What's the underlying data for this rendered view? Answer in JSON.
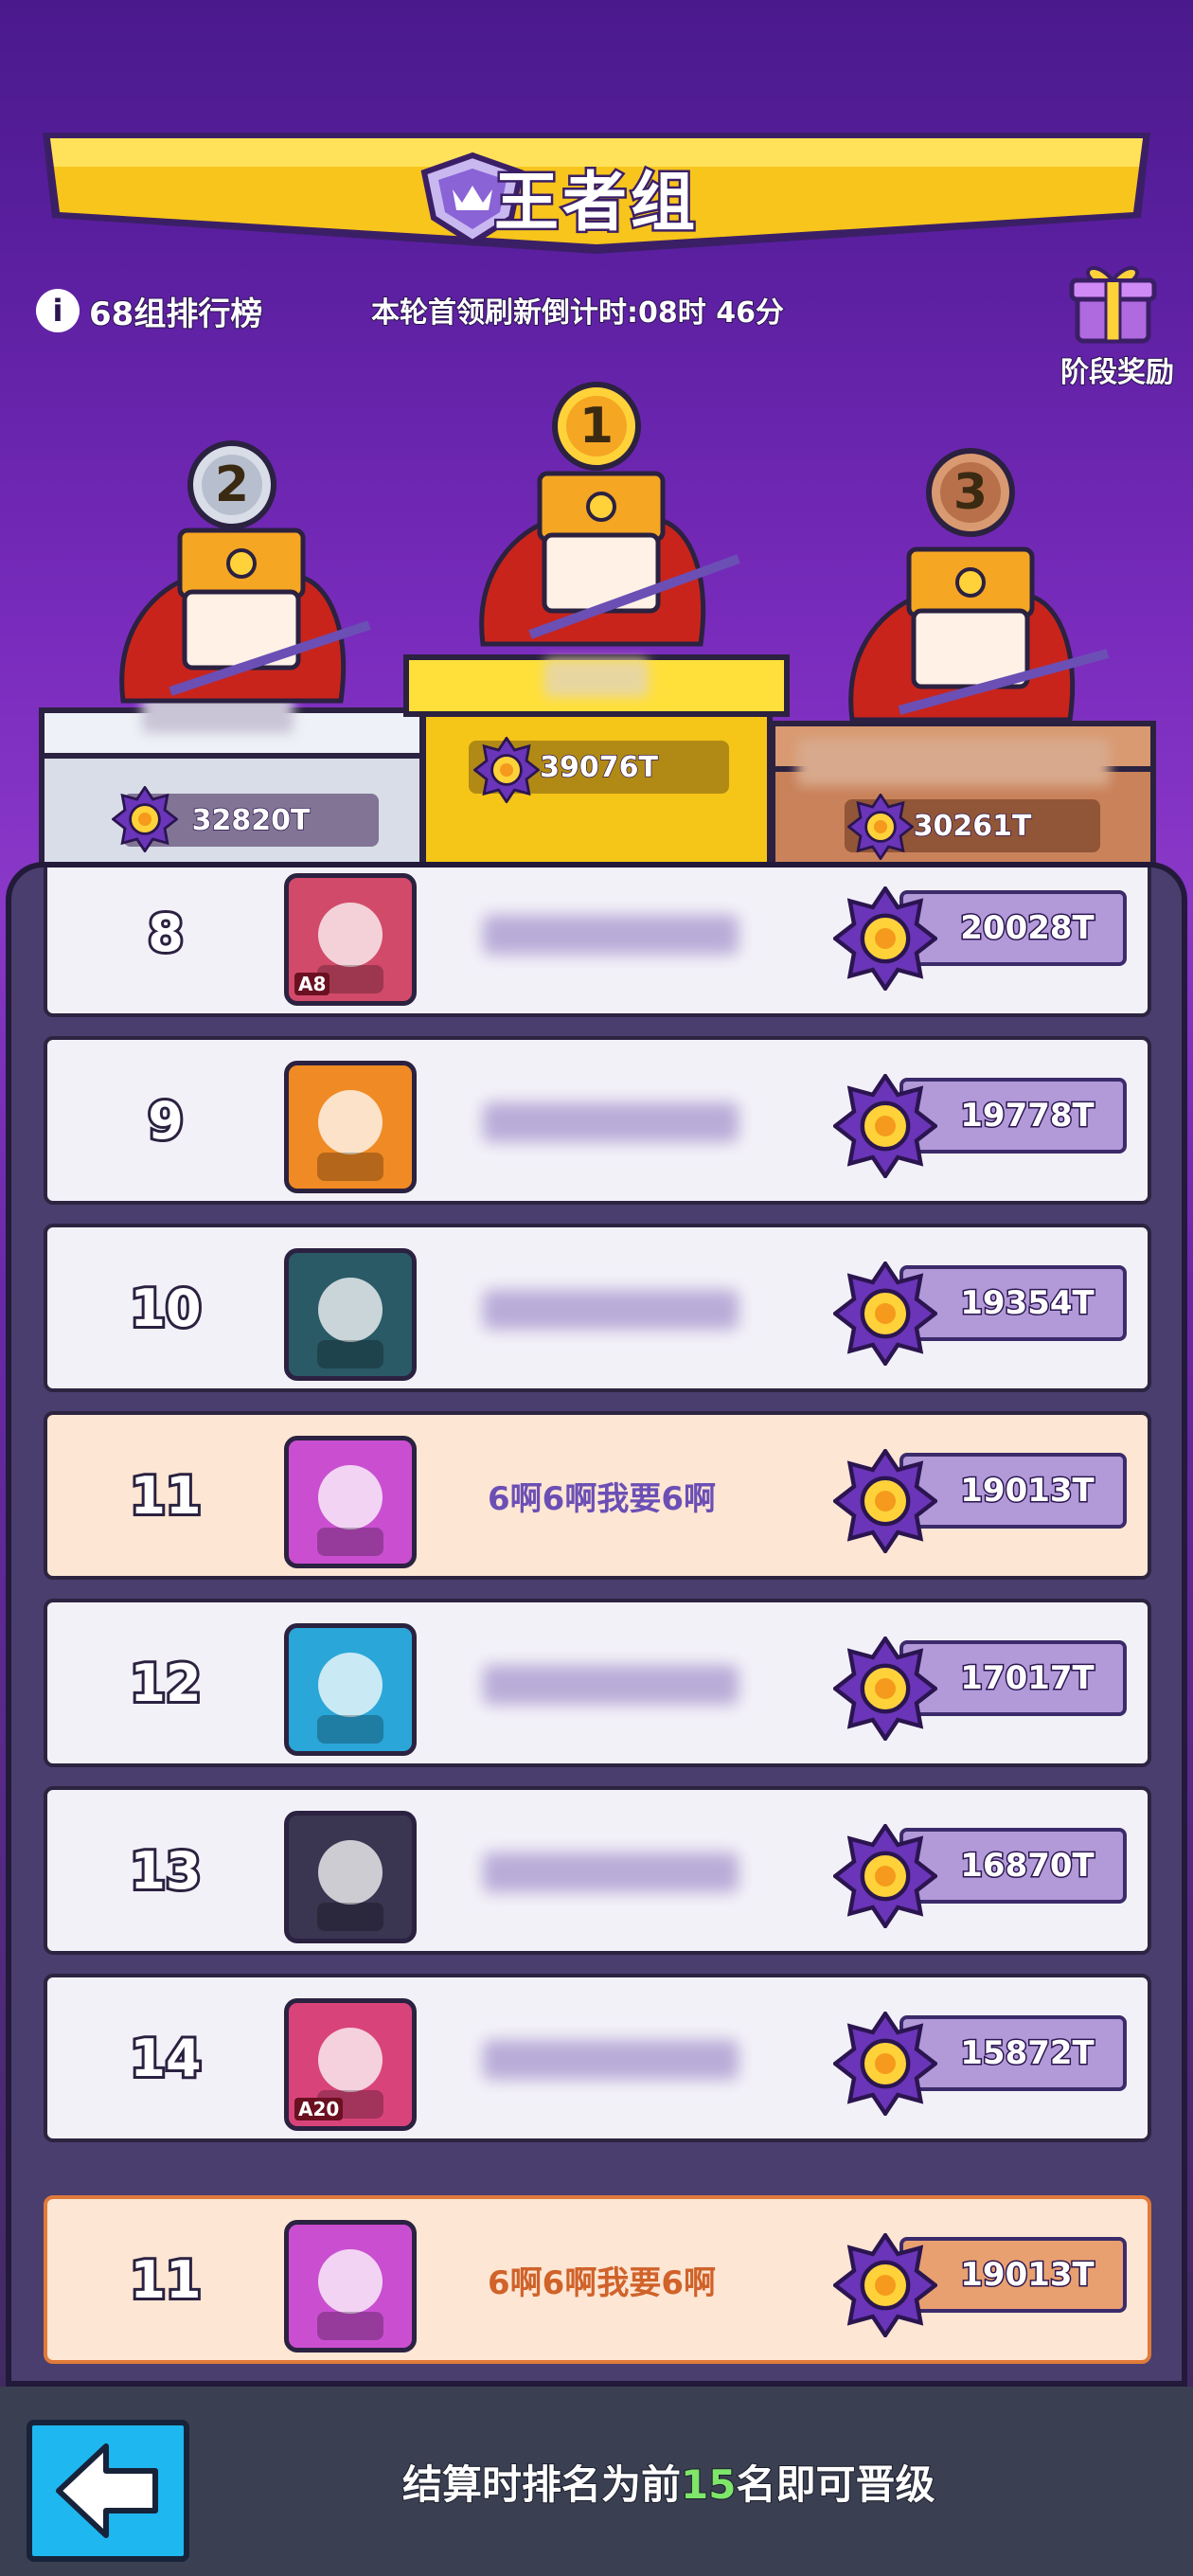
{
  "header": {
    "title": "王者组",
    "group_label": "68组排行榜",
    "countdown": "本轮首领刷新倒计时:08时 46分",
    "reward_label": "阶段奖励"
  },
  "podium": [
    {
      "rank": "2",
      "score": "32820T"
    },
    {
      "rank": "1",
      "score": "39076T"
    },
    {
      "rank": "3",
      "score": "30261T"
    }
  ],
  "rows": [
    {
      "rank": "8",
      "name": "",
      "score": "20028T",
      "avatar_tag": "A8"
    },
    {
      "rank": "9",
      "name": "",
      "score": "19778T",
      "avatar_tag": ""
    },
    {
      "rank": "10",
      "name": "",
      "score": "19354T",
      "avatar_tag": ""
    },
    {
      "rank": "11",
      "name": "6啊6啊我要6啊",
      "score": "19013T",
      "avatar_tag": ""
    },
    {
      "rank": "12",
      "name": "",
      "score": "17017T",
      "avatar_tag": ""
    },
    {
      "rank": "13",
      "name": "",
      "score": "16870T",
      "avatar_tag": ""
    },
    {
      "rank": "14",
      "name": "",
      "score": "15872T",
      "avatar_tag": "A20"
    }
  ],
  "me": {
    "rank": "11",
    "name": "6啊6啊我要6啊",
    "score": "19013T"
  },
  "footer": {
    "text_before": "结算时排名为前",
    "highlight": "15",
    "text_after": "名即可晋级"
  },
  "colors": {
    "banner": "#f7c51c",
    "gold": "#f5c518",
    "silver": "#d8dde8",
    "bronze": "#c9825a",
    "highlight_green": "#7ee66a",
    "back_button": "#1eb7f0"
  },
  "icons": [
    "crown-badge-icon",
    "info-icon",
    "gift-icon",
    "coin-icon",
    "back-arrow-icon"
  ]
}
